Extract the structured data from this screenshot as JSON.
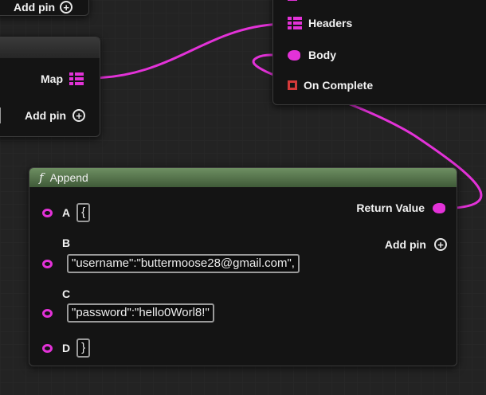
{
  "top_left_node": {
    "add_pin_label": "Add pin"
  },
  "map_node": {
    "map_label": "Map",
    "add_pin_label": "Add pin"
  },
  "request_node": {
    "headers_label": "Headers",
    "body_label": "Body",
    "on_complete_label": "On Complete"
  },
  "append_node": {
    "title": "Append",
    "return_label": "Return Value",
    "add_pin_label": "Add pin",
    "pins": [
      {
        "label": "A",
        "value": "{"
      },
      {
        "label": "B",
        "value": "\"username\":\"buttermoose28@gmail.com\","
      },
      {
        "label": "C",
        "value": "\"password\":\"hello0Worl8!\""
      },
      {
        "label": "D",
        "value": "}"
      }
    ]
  },
  "colors": {
    "wire": "#e332d8",
    "header": "#5f7f54",
    "exec": "#d43a3a"
  },
  "icons": [
    "map-icon",
    "add-pin-icon",
    "function-icon",
    "exec-pin-icon"
  ]
}
